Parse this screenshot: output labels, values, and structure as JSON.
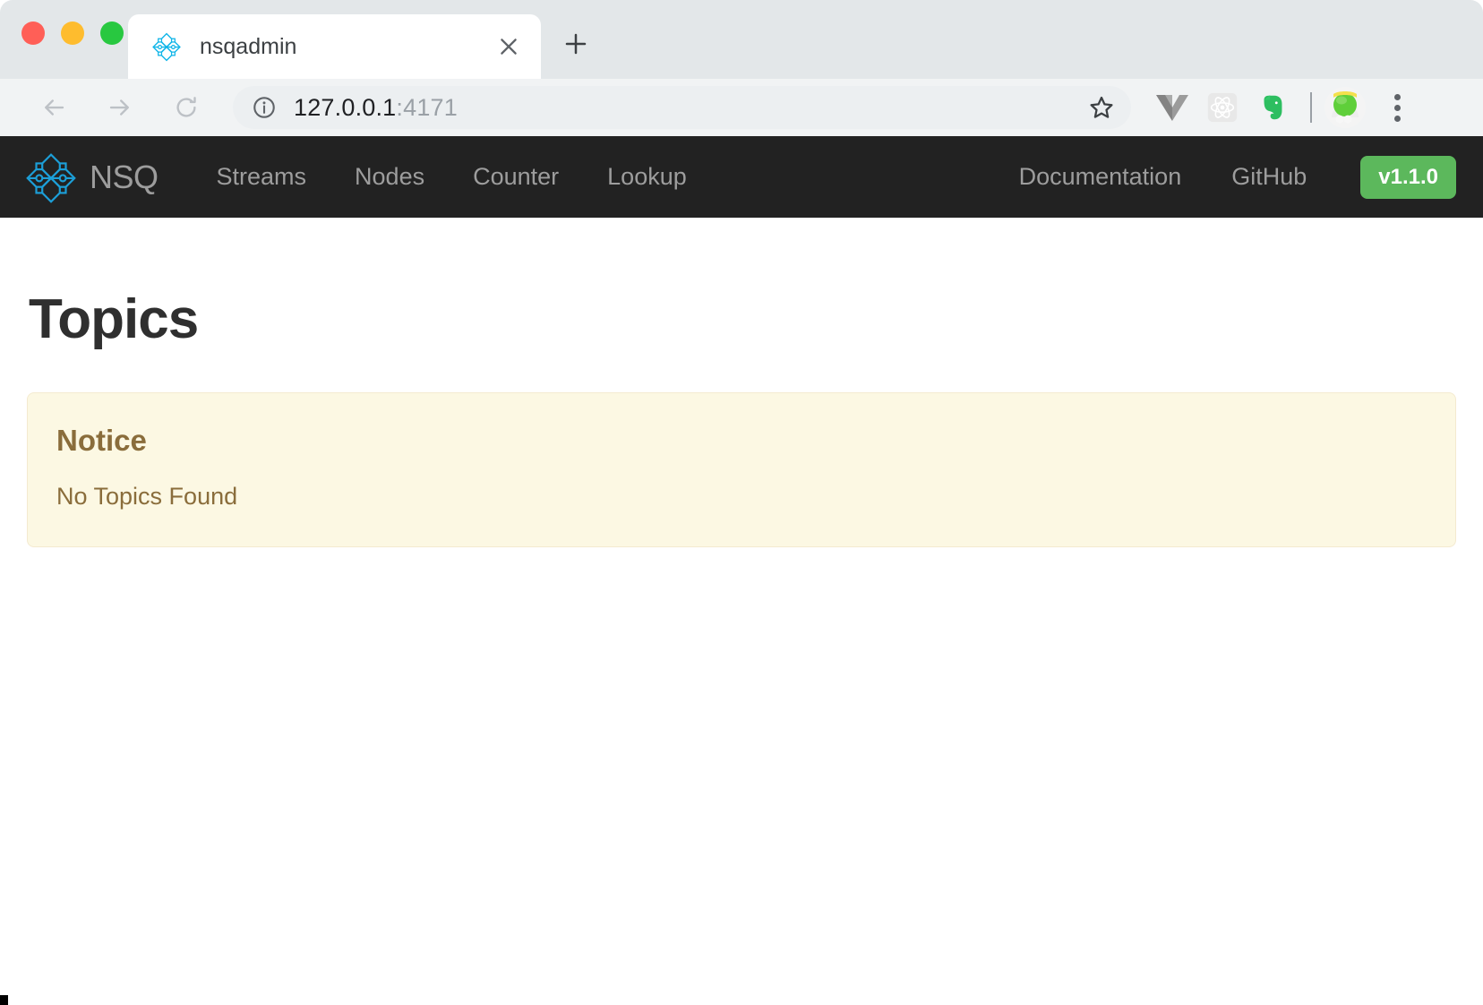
{
  "browser": {
    "traffic_lights": [
      {
        "name": "close",
        "color": "#ff5f57"
      },
      {
        "name": "minimize",
        "color": "#febc2e"
      },
      {
        "name": "maximize",
        "color": "#28c840"
      }
    ],
    "tab": {
      "title": "nsqadmin",
      "favicon": "nsq-logo-icon",
      "close_label": "×"
    },
    "new_tab_label": "+",
    "toolbar": {
      "back_icon": "arrow-left-icon",
      "forward_icon": "arrow-right-icon",
      "reload_icon": "reload-icon",
      "site_info_icon": "info-icon",
      "url_host": "127.0.0.1",
      "url_port": ":4171",
      "url_full": "127.0.0.1:4171",
      "star_icon": "star-outline-icon",
      "extensions": [
        {
          "name": "vue-devtools-icon",
          "color": "#8e8e8e"
        },
        {
          "name": "react-devtools-icon",
          "color": "#dedede"
        },
        {
          "name": "evernote-icon",
          "color": "#2dbe60"
        }
      ],
      "avatar_name": "profile-avatar",
      "menu_icon": "three-dot-menu-icon"
    }
  },
  "app": {
    "brand": {
      "logo_icon": "nsq-logo-icon",
      "name": "NSQ"
    },
    "nav_links": [
      {
        "label": "Streams"
      },
      {
        "label": "Nodes"
      },
      {
        "label": "Counter"
      },
      {
        "label": "Lookup"
      }
    ],
    "nav_right_links": [
      {
        "label": "Documentation"
      },
      {
        "label": "GitHub"
      }
    ],
    "version": "v1.1.0",
    "version_color": "#5cb85c",
    "navbar_bg": "#222222"
  },
  "page": {
    "title": "Topics",
    "alert": {
      "heading": "Notice",
      "message": "No Topics Found",
      "bg": "#fcf8e3",
      "border": "#f4ead0",
      "text_color": "#8a6d3b"
    }
  }
}
